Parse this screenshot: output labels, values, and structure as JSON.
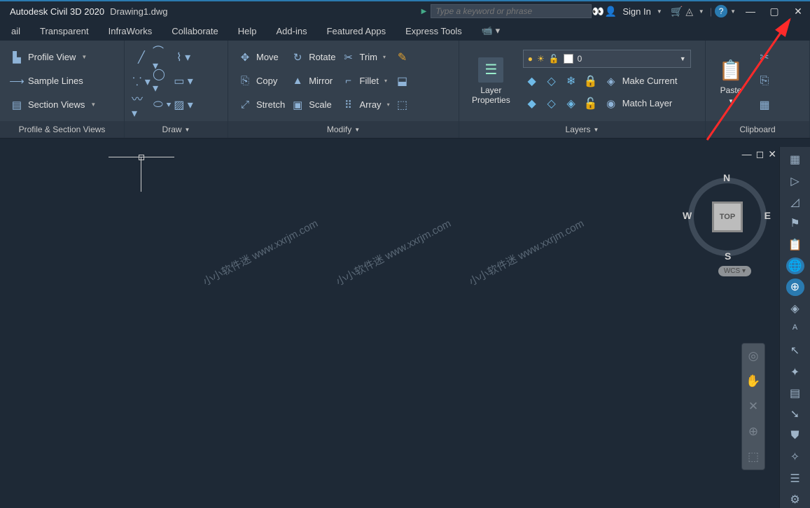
{
  "title": {
    "app": "Autodesk Civil 3D 2020",
    "file": "Drawing1.dwg",
    "search_placeholder": "Type a keyword or phrase",
    "signin": "Sign In"
  },
  "menu": {
    "items": [
      "ail",
      "Transparent",
      "InfraWorks",
      "Collaborate",
      "Help",
      "Add-ins",
      "Featured Apps",
      "Express Tools"
    ]
  },
  "ribbon": {
    "profile": {
      "title": "Profile & Section Views",
      "profile_view": "Profile View",
      "sample_lines": "Sample Lines",
      "section_views": "Section Views"
    },
    "draw": {
      "title": "Draw"
    },
    "modify": {
      "title": "Modify",
      "move": "Move",
      "rotate": "Rotate",
      "trim": "Trim",
      "copy": "Copy",
      "mirror": "Mirror",
      "fillet": "Fillet",
      "stretch": "Stretch",
      "scale": "Scale",
      "array": "Array"
    },
    "layers": {
      "title": "Layers",
      "properties": "Layer\nProperties",
      "current": "0",
      "make_current": "Make Current",
      "match_layer": "Match Layer"
    },
    "clipboard": {
      "title": "Clipboard",
      "paste": "Paste"
    }
  },
  "viewcube": {
    "top": "TOP",
    "n": "N",
    "s": "S",
    "e": "E",
    "w": "W",
    "wcs": "WCS"
  },
  "watermark": "小小软件迷 www.xxrjm.com"
}
